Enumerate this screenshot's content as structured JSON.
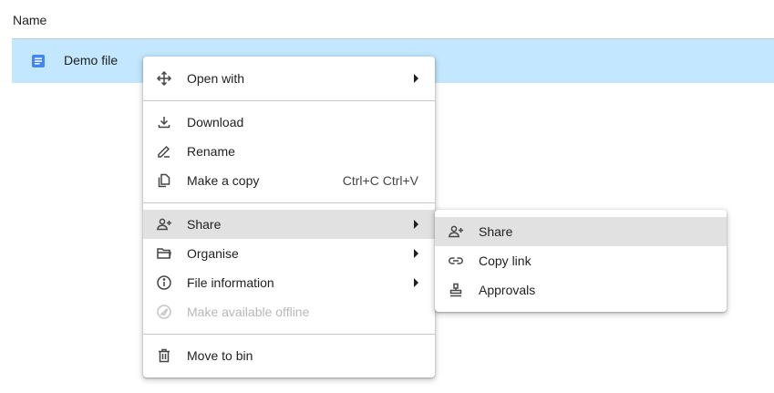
{
  "list": {
    "column_header": "Name",
    "file": {
      "name": "Demo file",
      "icon": "docs-file-icon",
      "icon_color": "#4285f4",
      "row_color": "#c2e7ff"
    }
  },
  "context_menu": {
    "items": [
      {
        "label": "Open with",
        "icon": "open-with-icon",
        "submenu": true
      },
      {
        "label": "Download",
        "icon": "download-icon"
      },
      {
        "label": "Rename",
        "icon": "rename-icon"
      },
      {
        "label": "Make a copy",
        "icon": "copy-icon",
        "shortcut": "Ctrl+C Ctrl+V"
      },
      {
        "label": "Share",
        "icon": "share-icon",
        "submenu": true,
        "highlighted": true
      },
      {
        "label": "Organise",
        "icon": "folder-icon",
        "submenu": true
      },
      {
        "label": "File information",
        "icon": "info-icon",
        "submenu": true
      },
      {
        "label": "Make available offline",
        "icon": "offline-icon",
        "disabled": true
      },
      {
        "label": "Move to bin",
        "icon": "trash-icon"
      }
    ]
  },
  "share_submenu": {
    "items": [
      {
        "label": "Share",
        "icon": "share-icon",
        "highlighted": true
      },
      {
        "label": "Copy link",
        "icon": "link-icon"
      },
      {
        "label": "Approvals",
        "icon": "approvals-icon"
      }
    ]
  },
  "colors": {
    "highlight": "#e1e1e1",
    "divider": "#c4c7c5",
    "disabled_text": "#b8b8b8"
  }
}
